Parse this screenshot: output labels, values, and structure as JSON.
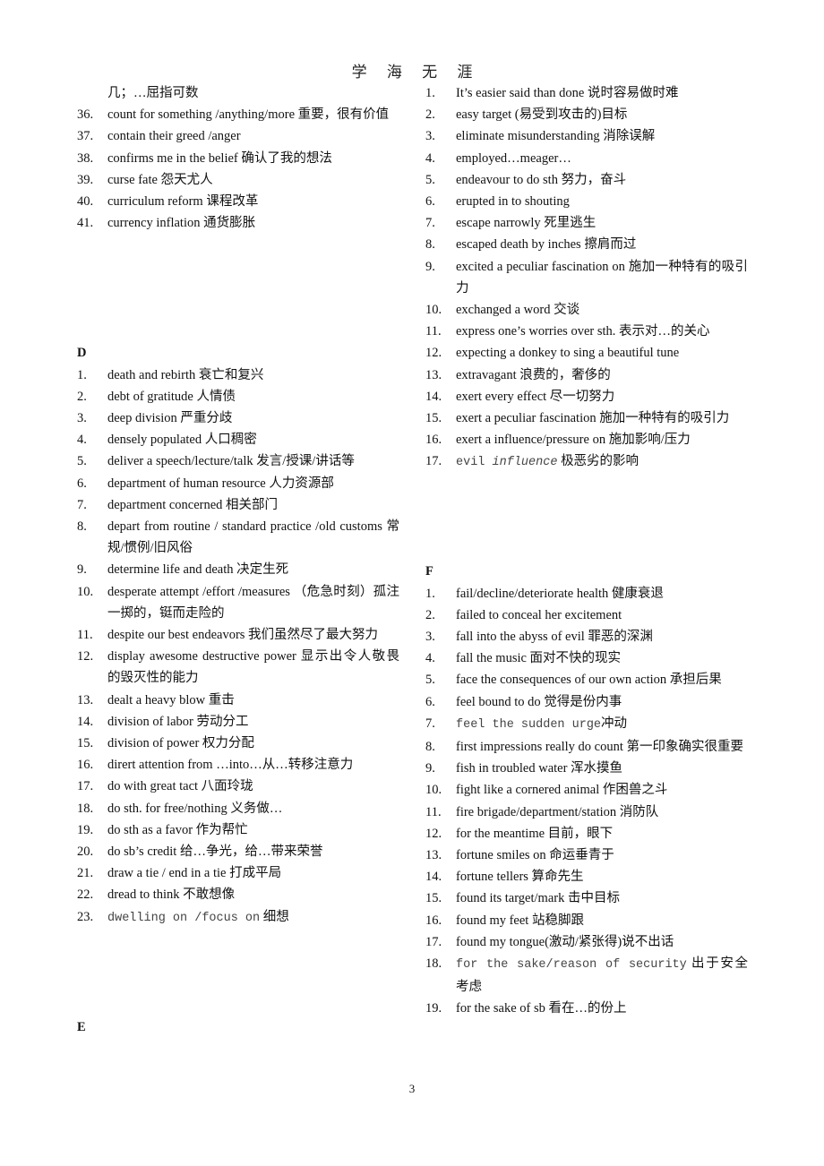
{
  "header": {
    "chars": [
      "学",
      "海",
      "无",
      "涯"
    ]
  },
  "left_column": {
    "continuation": "几；…屈指可数",
    "c_items": [
      {
        "num": "36.",
        "text": "count for something /anything/more 重要，很有价值"
      },
      {
        "num": "37.",
        "text": "contain their greed /anger"
      },
      {
        "num": "38.",
        "text": "confirms me in the belief  确认了我的想法"
      },
      {
        "num": "39.",
        "text": "curse fate  怨天尤人"
      },
      {
        "num": "40.",
        "text": "curriculum reform 课程改革"
      },
      {
        "num": "41.",
        "text": "currency inflation  通货膨胀"
      }
    ],
    "d_heading": "D",
    "d_items": [
      {
        "num": "1.",
        "text": "death and rebirth  衰亡和复兴"
      },
      {
        "num": "2.",
        "text": "debt of gratitude    人情债"
      },
      {
        "num": "3.",
        "text": "deep division  严重分歧"
      },
      {
        "num": "4.",
        "text": "densely populated    人口稠密"
      },
      {
        "num": "5.",
        "text": "deliver a speech/lecture/talk  发言/授课/讲话等"
      },
      {
        "num": "6.",
        "text": "department of human resource  人力资源部"
      },
      {
        "num": "7.",
        "text": "department concerned  相关部门"
      },
      {
        "num": "8.",
        "text": "depart from routine / standard practice /old customs  常规/惯例/旧风俗"
      },
      {
        "num": "9.",
        "text": "determine life and death    决定生死"
      },
      {
        "num": "10.",
        "text": "desperate attempt /effort /measures  （危急时刻）孤注一掷的，铤而走险的"
      },
      {
        "num": "11.",
        "text": "despite our best endeavors 我们虽然尽了最大努力"
      },
      {
        "num": "12.",
        "text": "display awesome destructive power  显示出令人敬畏的毁灭性的能力"
      },
      {
        "num": "13.",
        "text": "dealt a heavy blow 重击"
      },
      {
        "num": "14.",
        "text": "division of labor    劳动分工"
      },
      {
        "num": "15.",
        "text": "division of power    权力分配"
      },
      {
        "num": "16.",
        "text": "dirert attention from  …into…从…转移注意力"
      },
      {
        "num": "17.",
        "text": "do with great tact  八面玲珑"
      },
      {
        "num": "18.",
        "text": "do sth. for free/nothing  义务做…"
      },
      {
        "num": "19.",
        "text": "do sth as a favor  作为帮忙"
      },
      {
        "num": "20.",
        "text": "do sb’s credit  给…争光，给…带来荣誉"
      },
      {
        "num": "21.",
        "text": "draw a tie    / end in a tie    打成平局"
      },
      {
        "num": "22.",
        "text": "dread to think  不敢想像"
      },
      {
        "num": "23.",
        "text_mono": "dwelling on /focus on",
        "text": " 细想"
      }
    ],
    "e_heading": "E"
  },
  "right_column": {
    "e_items": [
      {
        "num": "1.",
        "text": "It’s easier said than done    说时容易做时难"
      },
      {
        "num": "2.",
        "text": "easy target (易受到攻击的)目标"
      },
      {
        "num": "3.",
        "text": "eliminate misunderstanding  消除误解"
      },
      {
        "num": "4.",
        "text": "employed…meager…"
      },
      {
        "num": "5.",
        "text": "endeavour to do sth  努力，奋斗"
      },
      {
        "num": "6.",
        "text": "erupted in to shouting"
      },
      {
        "num": "7.",
        "text": "escape narrowly  死里逃生"
      },
      {
        "num": "8.",
        "text": "escaped death by inches 擦肩而过"
      },
      {
        "num": "9.",
        "text": "excited a peculiar fascination on  施加一种特有的吸引力"
      },
      {
        "num": "10.",
        "text": "exchanged a word  交谈"
      },
      {
        "num": "11.",
        "text": "express one’s worries over sth.  表示对…的关心"
      },
      {
        "num": "12.",
        "text": "expecting a donkey to sing a beautiful tune"
      },
      {
        "num": "13.",
        "text": "extravagant  浪费的，奢侈的"
      },
      {
        "num": "14.",
        "text": "exert every effect  尽一切努力"
      },
      {
        "num": "15.",
        "text": "exert a peculiar fascination  施加一种特有的吸引力"
      },
      {
        "num": "16.",
        "text": "exert a influence/pressure on    施加影响/压力"
      },
      {
        "num": "17.",
        "text_mono": "evil ",
        "text_italic": "influence",
        "text": " 极恶劣的影响"
      }
    ],
    "f_heading": "F",
    "f_items": [
      {
        "num": "1.",
        "text": "fail/decline/deteriorate health  健康衰退"
      },
      {
        "num": "2.",
        "text": "failed to conceal her excitement"
      },
      {
        "num": "3.",
        "text": "fall into the abyss of evil    罪恶的深渊"
      },
      {
        "num": "4.",
        "text": "fall the music  面对不快的现实"
      },
      {
        "num": "5.",
        "text": "face the consequences of our own action  承担后果"
      },
      {
        "num": "6.",
        "text": "feel bound to do  觉得是份内事"
      },
      {
        "num": "7.",
        "text_mono": "feel the sudden urge",
        "text": "冲动"
      },
      {
        "num": "8.",
        "text": "first impressions really do count 第一印象确实很重要"
      },
      {
        "num": "9.",
        "text": "fish in troubled water 浑水摸鱼"
      },
      {
        "num": "10.",
        "text": "fight like a cornered animal 作困兽之斗"
      },
      {
        "num": "11.",
        "text": "fire brigade/department/station 消防队"
      },
      {
        "num": "12.",
        "text": "for the meantime 目前，眼下"
      },
      {
        "num": "13.",
        "text": "fortune    smiles on    命运垂青于"
      },
      {
        "num": "14.",
        "text": "fortune    tellers    算命先生"
      },
      {
        "num": "15.",
        "text": "found its target/mark 击中目标"
      },
      {
        "num": "16.",
        "text": "found my feet 站稳脚跟"
      },
      {
        "num": "17.",
        "text": "found my tongue(激动/紧张得)说不出话"
      },
      {
        "num": "18.",
        "text_mono": "for the sake/reason of security",
        "text": " 出于安全考虑"
      },
      {
        "num": "19.",
        "text": "for the sake of sb  看在…的份上"
      }
    ]
  },
  "footer": {
    "page_number": "3"
  }
}
